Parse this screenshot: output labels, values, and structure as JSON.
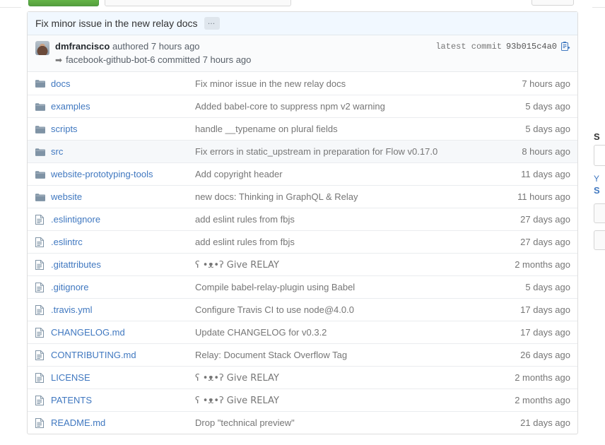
{
  "toolbar": {
    "clone_button_label": "",
    "clone_url_value": "",
    "secondary_button_label": ""
  },
  "commit_header": {
    "title": "Fix minor issue in the new relay docs",
    "more_button_label": "…",
    "author": "dmfrancisco",
    "author_action": "authored 7 hours ago",
    "committer_line": "facebook-github-bot-6 committed 7 hours ago",
    "arrow_icon": "arrow-right-icon",
    "latest_commit_label": "latest commit",
    "latest_commit_sha": "93b015c4a0",
    "copy_icon": "clipboard-copy-icon",
    "avatar": "user-avatar"
  },
  "table": {
    "rows": [
      {
        "icon": "folder-icon",
        "type": "folder",
        "name": "docs",
        "message": "Fix minor issue in the new relay docs",
        "age": "7 hours ago",
        "hover": false
      },
      {
        "icon": "folder-icon",
        "type": "folder",
        "name": "examples",
        "message": "Added babel-core to suppress npm v2 warning",
        "age": "5 days ago",
        "hover": false
      },
      {
        "icon": "folder-icon",
        "type": "folder",
        "name": "scripts",
        "message": "handle __typename on plural fields",
        "age": "5 days ago",
        "hover": false
      },
      {
        "icon": "folder-icon",
        "type": "folder",
        "name": "src",
        "message": "Fix errors in static_upstream in preparation for Flow v0.17.0",
        "age": "8 hours ago",
        "hover": true
      },
      {
        "icon": "folder-icon",
        "type": "folder",
        "name": "website-prototyping-tools",
        "message": "Add copyright header",
        "age": "11 days ago",
        "hover": false
      },
      {
        "icon": "folder-icon",
        "type": "folder",
        "name": "website",
        "message": "new docs: Thinking in GraphQL & Relay",
        "age": "11 hours ago",
        "hover": false
      },
      {
        "icon": "file-icon",
        "type": "file",
        "name": ".eslintignore",
        "message": "add eslint rules from fbjs",
        "age": "27 days ago",
        "hover": false
      },
      {
        "icon": "file-icon",
        "type": "file",
        "name": ".eslintrc",
        "message": "add eslint rules from fbjs",
        "age": "27 days ago",
        "hover": false
      },
      {
        "icon": "file-icon",
        "type": "file",
        "name": ".gitattributes",
        "message": "ʕ •ᴥ•ʔ Give RELAY",
        "age": "2 months ago",
        "hover": false
      },
      {
        "icon": "file-icon",
        "type": "file",
        "name": ".gitignore",
        "message": "Compile babel-relay-plugin using Babel",
        "age": "5 days ago",
        "hover": false
      },
      {
        "icon": "file-icon",
        "type": "file",
        "name": ".travis.yml",
        "message": "Configure Travis CI to use node@4.0.0",
        "age": "17 days ago",
        "hover": false
      },
      {
        "icon": "file-icon",
        "type": "file",
        "name": "CHANGELOG.md",
        "message": "Update CHANGELOG for v0.3.2",
        "age": "17 days ago",
        "hover": false
      },
      {
        "icon": "file-icon",
        "type": "file",
        "name": "CONTRIBUTING.md",
        "message": "Relay: Document Stack Overflow Tag",
        "age": "26 days ago",
        "hover": false
      },
      {
        "icon": "file-icon",
        "type": "file",
        "name": "LICENSE",
        "message": "ʕ •ᴥ•ʔ Give RELAY",
        "age": "2 months ago",
        "hover": false
      },
      {
        "icon": "file-icon",
        "type": "file",
        "name": "PATENTS",
        "message": "ʕ •ᴥ•ʔ Give RELAY",
        "age": "2 months ago",
        "hover": false
      },
      {
        "icon": "file-icon",
        "type": "file",
        "name": "README.md",
        "message": "Drop \"technical preview\"",
        "age": "21 days ago",
        "hover": false
      }
    ]
  },
  "sidebar": {
    "heading": "S",
    "link_y": "Y",
    "link_s": "S"
  },
  "colors": {
    "link": "#4078c0",
    "muted": "#767676",
    "commit_header_bg": "#f1f8ff",
    "row_hover": "#f6f8fa",
    "border": "#ddd",
    "folder_icon": "#7f93a5",
    "green_button": "#6cc644"
  }
}
